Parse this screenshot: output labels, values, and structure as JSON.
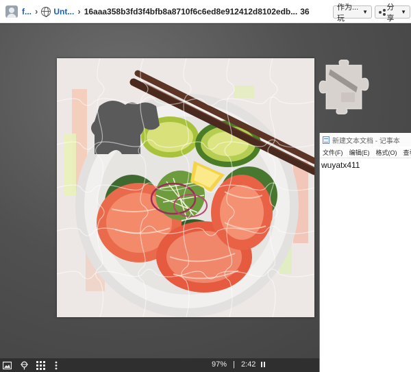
{
  "topbar": {
    "user_label": "f...",
    "project_label": "Unt...",
    "hash_label": "16aaa358b3fd3f4bfb8a8710f6c6ed8e912412d8102edb...",
    "count_label": "36",
    "play_as_label": "作为...玩",
    "share_label": "分享"
  },
  "notepad": {
    "title": "新建文本文档 - 记事本",
    "menu": [
      "文件(F)",
      "编辑(E)",
      "格式(O)",
      "查看"
    ],
    "content": "wuyatx411"
  },
  "status": {
    "progress_percent": "97%",
    "separator": "|",
    "timer": "2:42"
  },
  "icons": {
    "preview": "image-icon",
    "ghost": "pin-icon",
    "sort": "grid-icon",
    "menu": "more-vertical-icon"
  },
  "colors": {
    "topbar_bg": "#ffffff",
    "link": "#1a5fb4",
    "bottombar_bg": "#2f2f2f",
    "play_bg": "#4a4a4a"
  }
}
